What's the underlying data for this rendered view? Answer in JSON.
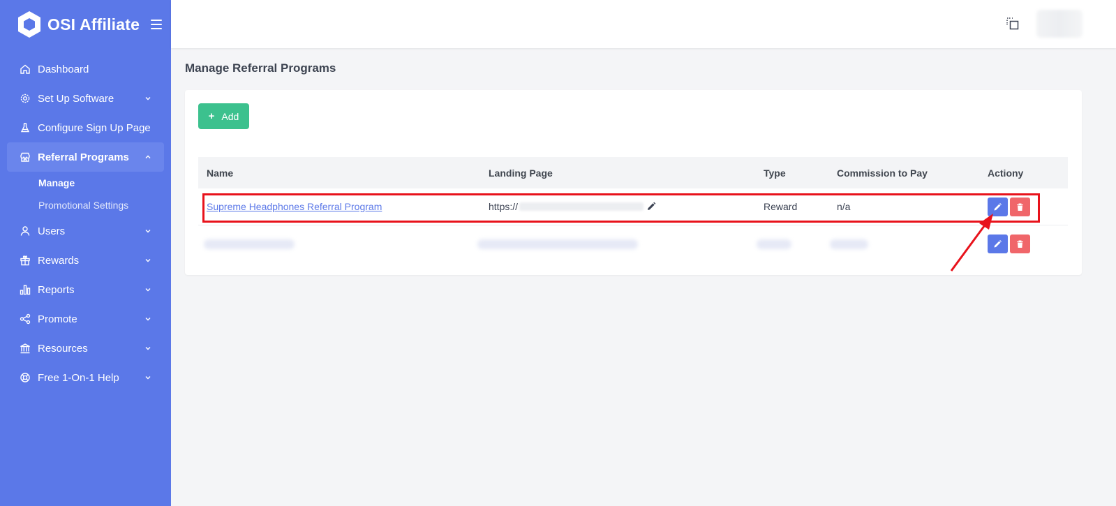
{
  "app": {
    "name": "OSI Affiliate"
  },
  "sidebar": {
    "items": [
      {
        "label": "Dashboard",
        "icon": "home-icon",
        "expandable": false
      },
      {
        "label": "Set Up Software",
        "icon": "gear-icon",
        "expandable": true
      },
      {
        "label": "Configure Sign Up Page",
        "icon": "flask-icon",
        "expandable": false
      },
      {
        "label": "Referral Programs",
        "icon": "store-icon",
        "expandable": true,
        "active": true
      },
      {
        "label": "Users",
        "icon": "user-icon",
        "expandable": true
      },
      {
        "label": "Rewards",
        "icon": "gift-icon",
        "expandable": true
      },
      {
        "label": "Reports",
        "icon": "bar-chart-icon",
        "expandable": true
      },
      {
        "label": "Promote",
        "icon": "share-icon",
        "expandable": true
      },
      {
        "label": "Resources",
        "icon": "bank-icon",
        "expandable": true
      },
      {
        "label": "Free 1-On-1 Help",
        "icon": "lifebuoy-icon",
        "expandable": true
      }
    ],
    "sub_items": [
      {
        "label": "Manage",
        "current": true
      },
      {
        "label": "Promotional Settings",
        "current": false
      }
    ]
  },
  "page": {
    "title": "Manage Referral Programs"
  },
  "toolbar": {
    "add_label": "Add"
  },
  "table": {
    "columns": [
      "Name",
      "Landing Page",
      "Type",
      "Commission to Pay",
      "Actiony"
    ],
    "rows": [
      {
        "name": "Supreme Headphones Referral Program",
        "landing_page": "https://",
        "type": "Reward",
        "commission": "n/a"
      }
    ]
  },
  "colors": {
    "sidebar": "#5b78e8",
    "add_button": "#3cc18e",
    "edit_button": "#5b78e8",
    "delete_button": "#f0666a",
    "highlight": "#e8121b"
  }
}
